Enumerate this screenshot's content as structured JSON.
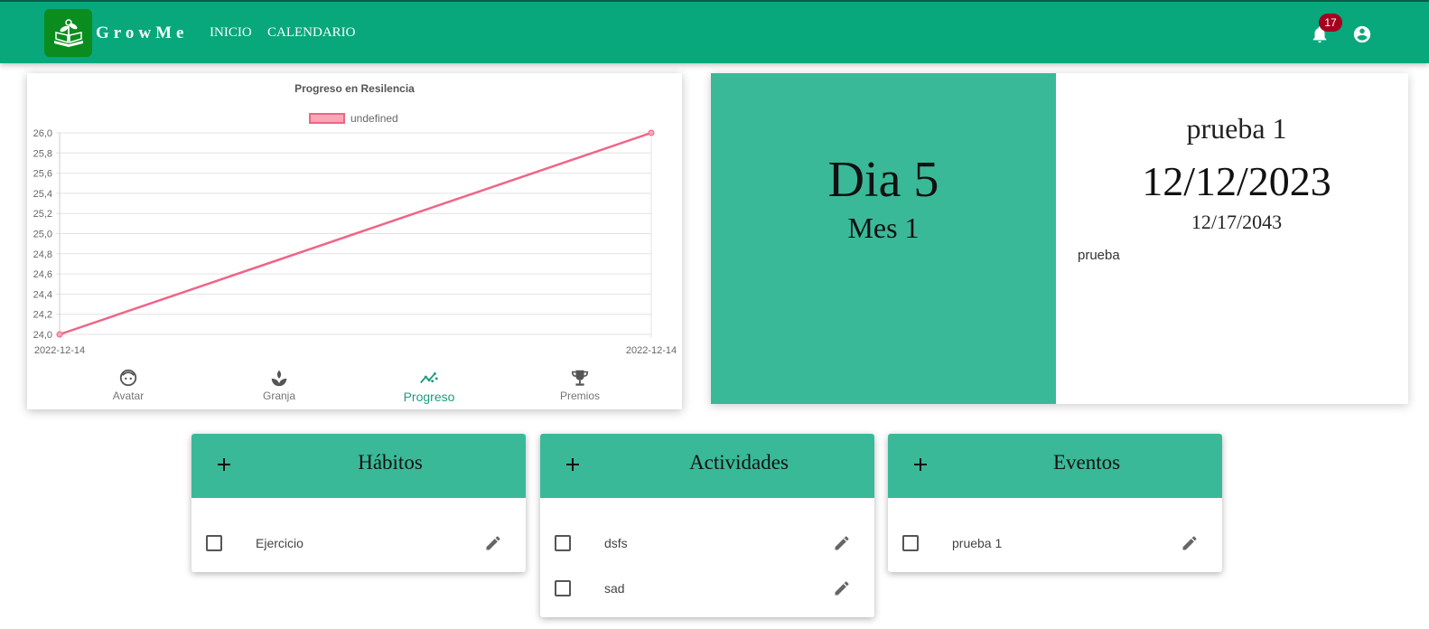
{
  "header": {
    "brand": "GrowMe",
    "nav": [
      "INICIO",
      "CALENDARIO"
    ],
    "notification_count": "17",
    "icons": [
      "logo-icon",
      "bell-icon",
      "account-icon"
    ]
  },
  "chart": {
    "tabs": [
      {
        "label": "Avatar",
        "icon": "face-icon"
      },
      {
        "label": "Granja",
        "icon": "sprout-icon"
      },
      {
        "label": "Progreso",
        "icon": "trending-icon",
        "active": true
      },
      {
        "label": "Premios",
        "icon": "trophy-icon"
      }
    ]
  },
  "chart_data": {
    "type": "line",
    "title": "Progreso en Resilencia",
    "x": [
      "2022-12-14",
      "2022-12-14"
    ],
    "series": [
      {
        "name": "undefined",
        "values": [
          24.0,
          26.0
        ]
      }
    ],
    "ylim": [
      24.0,
      26.0
    ],
    "yticks": [
      "24,0",
      "24,2",
      "24,4",
      "24,6",
      "24,8",
      "25,0",
      "25,2",
      "25,4",
      "25,6",
      "25,8",
      "26,0"
    ],
    "grid": true,
    "legend": "top",
    "colors": {
      "line": "#f06487",
      "fill": "#f7a7b6"
    }
  },
  "event": {
    "day": "Dia 5",
    "month": "Mes 1",
    "name": "prueba 1",
    "date": "12/12/2023",
    "end_date": "12/17/2043",
    "description": "prueba"
  },
  "lists": {
    "habitos": {
      "title": "Hábitos",
      "items": [
        "Ejercicio"
      ]
    },
    "actividades": {
      "title": "Actividades",
      "items": [
        "dsfs",
        "sad"
      ]
    },
    "eventos": {
      "title": "Eventos",
      "items": [
        "prueba 1"
      ]
    }
  },
  "colors": {
    "primary": "#08a77c",
    "accent": "#3ab999",
    "badge": "#a3001e"
  }
}
